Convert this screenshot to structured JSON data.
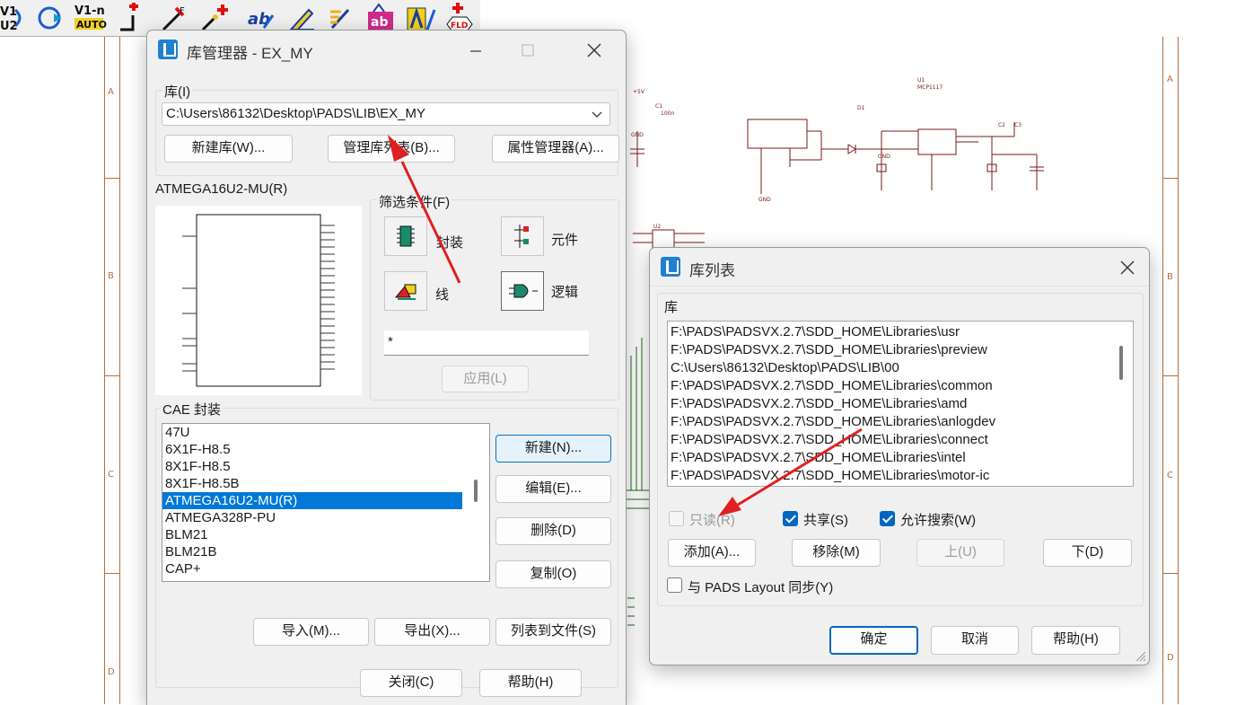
{
  "toolbar": {
    "buttons": [
      {
        "name": "v1-v2-icon",
        "text": "V1 V2"
      },
      {
        "name": "rotate-icon",
        "text": ""
      },
      {
        "name": "v1-n-auto-icon",
        "text": "V1-n AUTO"
      },
      {
        "name": "add-pin-icon",
        "text": ""
      },
      {
        "name": "add-field-icon",
        "text": ""
      },
      {
        "name": "add-part-icon",
        "text": ""
      },
      {
        "name": "ab-edit-icon",
        "text": ""
      },
      {
        "name": "edit-pen-icon",
        "text": ""
      },
      {
        "name": "wand-icon",
        "text": ""
      },
      {
        "name": "lib-ab-icon",
        "text": ""
      },
      {
        "name": "text-tool-icon",
        "text": ""
      },
      {
        "name": "fld-icon",
        "text": "FLD"
      }
    ]
  },
  "schematic": {
    "zones_left": [
      "A",
      "B",
      "C",
      "D"
    ],
    "zones_right": [
      "A",
      "B",
      "C",
      "D"
    ],
    "refs": [
      "+5V",
      "C1",
      "100n",
      "GND",
      "D1",
      "U1",
      "MCP1117",
      "C2",
      "C3",
      "GND",
      "GND",
      "U2"
    ]
  },
  "lib_manager": {
    "title": "库管理器 - EX_MY",
    "lib_label": "库(I)",
    "lib_path": "C:\\Users\\86132\\Desktop\\PADS\\LIB\\EX_MY",
    "btn_new_lib": "新建库(W)...",
    "btn_manage_list": "管理库列表(B)...",
    "btn_attr_manager": "属性管理器(A)...",
    "preview_label": "ATMEGA16U2-MU(R)",
    "filter_label": "筛选条件(F)",
    "filters": {
      "package": "封装",
      "part": "元件",
      "line": "线",
      "logic": "逻辑"
    },
    "filter_text": "*",
    "btn_apply": "应用(L)",
    "cae_label": "CAE 封装",
    "cae_items": [
      "47U",
      "6X1F-H8.5",
      "8X1F-H8.5",
      "8X1F-H8.5B",
      "ATMEGA16U2-MU(R)",
      "ATMEGA328P-PU",
      "BLM21",
      "BLM21B",
      "CAP+"
    ],
    "cae_selected": "ATMEGA16U2-MU(R)",
    "btn_new": "新建(N)...",
    "btn_edit": "编辑(E)...",
    "btn_delete": "删除(D)",
    "btn_copy": "复制(O)",
    "btn_import": "导入(M)...",
    "btn_export": "导出(X)...",
    "btn_list_to_file": "列表到文件(S)",
    "btn_close": "关闭(C)",
    "btn_help": "帮助(H)"
  },
  "lib_list": {
    "title": "库列表",
    "group_label": "库",
    "items": [
      "F:\\PADS\\PADSVX.2.7\\SDD_HOME\\Libraries\\usr",
      "F:\\PADS\\PADSVX.2.7\\SDD_HOME\\Libraries\\preview",
      "C:\\Users\\86132\\Desktop\\PADS\\LIB\\00",
      "F:\\PADS\\PADSVX.2.7\\SDD_HOME\\Libraries\\common",
      "F:\\PADS\\PADSVX.2.7\\SDD_HOME\\Libraries\\amd",
      "F:\\PADS\\PADSVX.2.7\\SDD_HOME\\Libraries\\anlogdev",
      "F:\\PADS\\PADSVX.2.7\\SDD_HOME\\Libraries\\connect",
      "F:\\PADS\\PADSVX.2.7\\SDD_HOME\\Libraries\\intel",
      "F:\\PADS\\PADSVX.2.7\\SDD_HOME\\Libraries\\motor-ic"
    ],
    "chk_readonly": "只读(R)",
    "chk_shared": "共享(S)",
    "chk_allow_search": "允许搜索(W)",
    "btn_add": "添加(A)...",
    "btn_remove": "移除(M)",
    "btn_up": "上(U)",
    "btn_down": "下(D)",
    "chk_sync": "与 PADS Layout 同步(Y)",
    "btn_ok": "确定",
    "btn_cancel": "取消",
    "btn_help": "帮助(H)",
    "state": {
      "readonly": false,
      "shared": true,
      "allow_search": true,
      "sync": false
    }
  },
  "colors": {
    "accent": "#0078d7",
    "arrow": "#e02020",
    "schematic_border": "#b07040"
  }
}
